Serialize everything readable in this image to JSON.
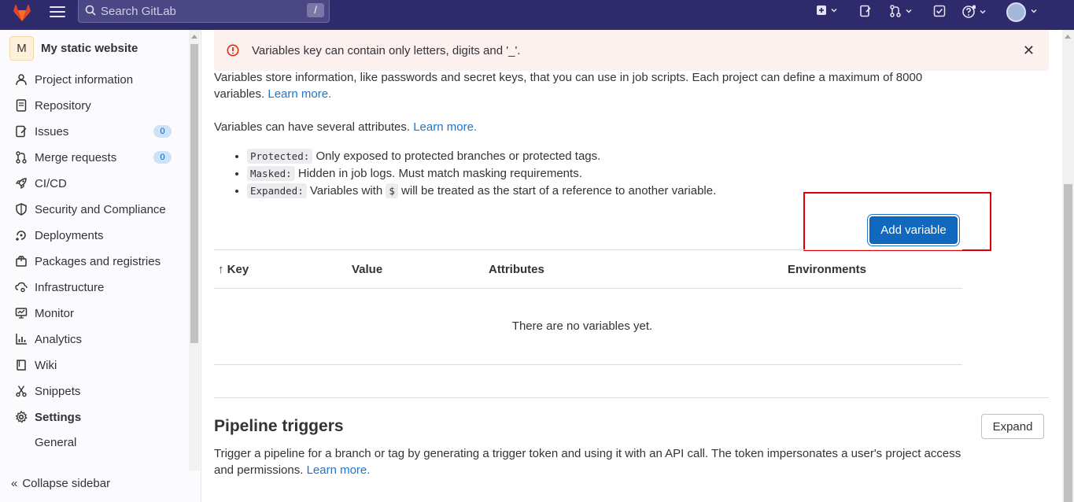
{
  "topbar": {
    "search_placeholder": "Search GitLab",
    "search_shortcut": "/"
  },
  "sidebar": {
    "project_initial": "M",
    "project_name": "My static website",
    "items": [
      {
        "label": "Project information",
        "icon": "project-info-icon"
      },
      {
        "label": "Repository",
        "icon": "repository-icon"
      },
      {
        "label": "Issues",
        "icon": "issues-icon",
        "count": "0"
      },
      {
        "label": "Merge requests",
        "icon": "merge-request-icon",
        "count": "0"
      },
      {
        "label": "CI/CD",
        "icon": "rocket-icon"
      },
      {
        "label": "Security and Compliance",
        "icon": "shield-icon"
      },
      {
        "label": "Deployments",
        "icon": "deployments-icon"
      },
      {
        "label": "Packages and registries",
        "icon": "package-icon"
      },
      {
        "label": "Infrastructure",
        "icon": "cloud-gear-icon"
      },
      {
        "label": "Monitor",
        "icon": "monitor-icon"
      },
      {
        "label": "Analytics",
        "icon": "analytics-icon"
      },
      {
        "label": "Wiki",
        "icon": "book-icon"
      },
      {
        "label": "Snippets",
        "icon": "snippet-icon"
      },
      {
        "label": "Settings",
        "icon": "gear-icon"
      }
    ],
    "sub_item": "General",
    "collapse_label": "Collapse sidebar"
  },
  "alert": {
    "message": "Variables key can contain only letters, digits and '_'."
  },
  "intro": {
    "text": "Variables store information, like passwords and secret keys, that you can use in job scripts. Each project can define a maximum of 8000",
    "text2": "variables.",
    "link": "Learn more."
  },
  "attributes_intro": {
    "text": "Variables can have several attributes.",
    "link": "Learn more."
  },
  "attributes": [
    {
      "code": "Protected:",
      "text": "Only exposed to protected branches or protected tags."
    },
    {
      "code": "Masked:",
      "text": "Hidden in job logs. Must match masking requirements."
    },
    {
      "code": "Expanded:",
      "text_before": "Variables with",
      "inline_code": "$",
      "text_after": "will be treated as the start of a reference to another variable."
    }
  ],
  "add_variable_label": "Add variable",
  "table": {
    "sort_arrow": "↑",
    "headers": [
      "Key",
      "Value",
      "Attributes",
      "Environments"
    ],
    "empty_text": "There are no variables yet."
  },
  "pipeline_triggers": {
    "title": "Pipeline triggers",
    "expand_label": "Expand",
    "description": "Trigger a pipeline for a branch or tag by generating a trigger token and using it with an API call. The token impersonates a user's project access",
    "description2": "and permissions.",
    "link": "Learn more."
  },
  "colors": {
    "navbar": "#2f2a6b",
    "primary": "#1068bf",
    "link": "#1f75cb",
    "alert_bg": "#fcf1ef",
    "danger": "#dd2b0e",
    "highlight": "#dd0000"
  }
}
